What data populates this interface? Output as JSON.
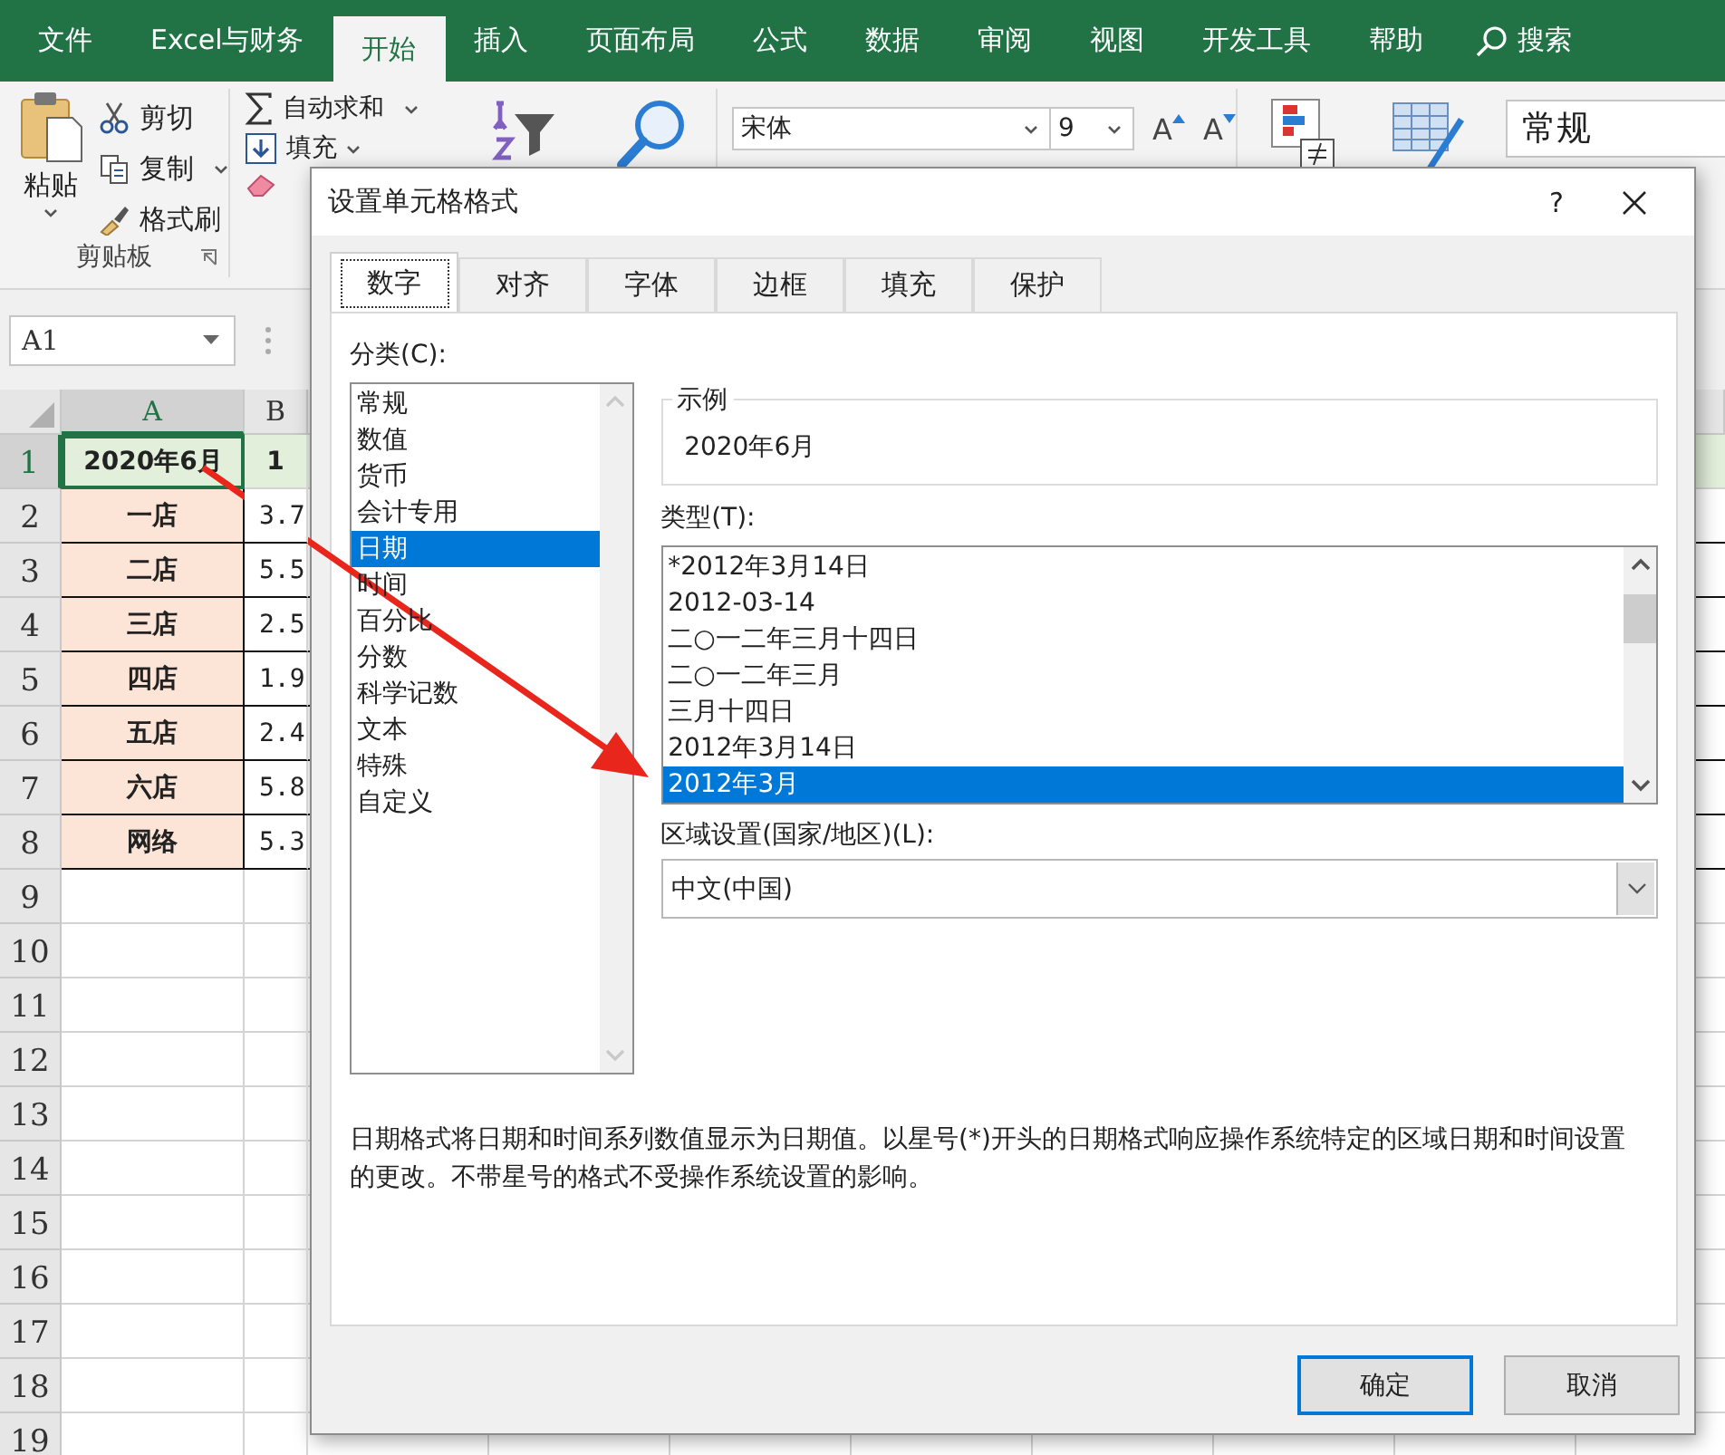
{
  "ribbon_tabs": [
    {
      "label": "文件",
      "selected": false
    },
    {
      "label": "Excel与财务",
      "selected": false
    },
    {
      "label": "开始",
      "selected": true
    },
    {
      "label": "插入",
      "selected": false
    },
    {
      "label": "页面布局",
      "selected": false
    },
    {
      "label": "公式",
      "selected": false
    },
    {
      "label": "数据",
      "selected": false
    },
    {
      "label": "审阅",
      "selected": false
    },
    {
      "label": "视图",
      "selected": false
    },
    {
      "label": "开发工具",
      "selected": false
    },
    {
      "label": "帮助",
      "selected": false
    }
  ],
  "search": {
    "label": "搜索"
  },
  "ribbon": {
    "clipboard": {
      "paste": "粘贴",
      "cut": "剪切",
      "copy": "复制",
      "format_painter": "格式刷",
      "group_label": "剪贴板"
    },
    "editing": {
      "autosum": "自动求和",
      "fill": "填充"
    },
    "font": {
      "name": "宋体",
      "size": "9",
      "grow": "A",
      "shrink": "A"
    },
    "number_format": "常规"
  },
  "name_box": "A1",
  "sheet": {
    "columns": [
      {
        "label": "A",
        "selected": true
      },
      {
        "label": "B",
        "selected": false
      }
    ],
    "rows": [
      {
        "label": "1",
        "selected": true,
        "kind": "title",
        "cells": [
          "2020年6月",
          "1"
        ]
      },
      {
        "label": "2",
        "selected": false,
        "kind": "data",
        "cells": [
          "一店",
          "3.7"
        ]
      },
      {
        "label": "3",
        "selected": false,
        "kind": "data",
        "cells": [
          "二店",
          "5.5"
        ]
      },
      {
        "label": "4",
        "selected": false,
        "kind": "data",
        "cells": [
          "三店",
          "2.5"
        ]
      },
      {
        "label": "5",
        "selected": false,
        "kind": "data",
        "cells": [
          "四店",
          "1.9"
        ]
      },
      {
        "label": "6",
        "selected": false,
        "kind": "data",
        "cells": [
          "五店",
          "2.4"
        ]
      },
      {
        "label": "7",
        "selected": false,
        "kind": "data",
        "cells": [
          "六店",
          "5.8"
        ]
      },
      {
        "label": "8",
        "selected": false,
        "kind": "data",
        "cells": [
          "网络",
          "5.3"
        ]
      },
      {
        "label": "9",
        "selected": false,
        "kind": "blank"
      },
      {
        "label": "10",
        "selected": false,
        "kind": "blank"
      },
      {
        "label": "11",
        "selected": false,
        "kind": "blank"
      },
      {
        "label": "12",
        "selected": false,
        "kind": "blank"
      },
      {
        "label": "13",
        "selected": false,
        "kind": "blank"
      },
      {
        "label": "14",
        "selected": false,
        "kind": "blank"
      },
      {
        "label": "15",
        "selected": false,
        "kind": "blank"
      },
      {
        "label": "16",
        "selected": false,
        "kind": "blank"
      },
      {
        "label": "17",
        "selected": false,
        "kind": "blank"
      },
      {
        "label": "18",
        "selected": false,
        "kind": "blank"
      },
      {
        "label": "19",
        "selected": false,
        "kind": "blank"
      }
    ]
  },
  "dialog": {
    "title": "设置单元格格式",
    "help": "?",
    "tabs": [
      {
        "label": "数字",
        "selected": true
      },
      {
        "label": "对齐",
        "selected": false
      },
      {
        "label": "字体",
        "selected": false
      },
      {
        "label": "边框",
        "selected": false
      },
      {
        "label": "填充",
        "selected": false
      },
      {
        "label": "保护",
        "selected": false
      }
    ],
    "category_label": "分类(C):",
    "categories": [
      {
        "label": "常规",
        "selected": false
      },
      {
        "label": "数值",
        "selected": false
      },
      {
        "label": "货币",
        "selected": false
      },
      {
        "label": "会计专用",
        "selected": false
      },
      {
        "label": "日期",
        "selected": true
      },
      {
        "label": "时间",
        "selected": false
      },
      {
        "label": "百分比",
        "selected": false
      },
      {
        "label": "分数",
        "selected": false
      },
      {
        "label": "科学记数",
        "selected": false
      },
      {
        "label": "文本",
        "selected": false
      },
      {
        "label": "特殊",
        "selected": false
      },
      {
        "label": "自定义",
        "selected": false
      }
    ],
    "sample": {
      "label": "示例",
      "value": "2020年6月"
    },
    "type_label": "类型(T):",
    "types": [
      {
        "label": "*2012年3月14日",
        "selected": false
      },
      {
        "label": "2012-03-14",
        "selected": false
      },
      {
        "label": "二○一二年三月十四日",
        "selected": false
      },
      {
        "label": "二○一二年三月",
        "selected": false
      },
      {
        "label": "三月十四日",
        "selected": false
      },
      {
        "label": "2012年3月14日",
        "selected": false
      },
      {
        "label": "2012年3月",
        "selected": true
      }
    ],
    "locale_label": "区域设置(国家/地区)(L):",
    "locale": "中文(中国)",
    "description": "日期格式将日期和时间系列数值显示为日期值。以星号(*)开头的日期格式响应操作系统特定的区域日期和时间设置的更改。不带星号的格式不受操作系统设置的影响。",
    "buttons": [
      {
        "label": "确定",
        "default": true
      },
      {
        "label": "取消",
        "default": false
      }
    ]
  }
}
